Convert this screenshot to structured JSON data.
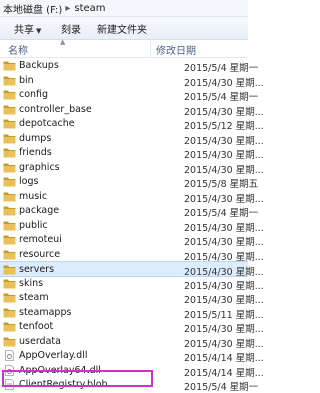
{
  "breadcrumb": {
    "part1": "本地磁盘 (F:)",
    "separator": "▸",
    "part2": "steam"
  },
  "toolbar": {
    "share_label": "共享",
    "burn_label": "刻录",
    "new_folder_label": "新建文件夹"
  },
  "columns": {
    "name": "名称",
    "date": "修改日期"
  },
  "rows": [
    {
      "name": "Backups",
      "date": "2015/5/4 星期一",
      "type": "folder"
    },
    {
      "name": "bin",
      "date": "2015/4/30 星期...",
      "type": "folder"
    },
    {
      "name": "config",
      "date": "2015/5/4 星期一",
      "type": "folder"
    },
    {
      "name": "controller_base",
      "date": "2015/4/30 星期...",
      "type": "folder"
    },
    {
      "name": "depotcache",
      "date": "2015/5/12 星期...",
      "type": "folder"
    },
    {
      "name": "dumps",
      "date": "2015/4/30 星期...",
      "type": "folder"
    },
    {
      "name": "friends",
      "date": "2015/4/30 星期...",
      "type": "folder"
    },
    {
      "name": "graphics",
      "date": "2015/4/30 星期...",
      "type": "folder"
    },
    {
      "name": "logs",
      "date": "2015/5/8 星期五",
      "type": "folder"
    },
    {
      "name": "music",
      "date": "2015/4/30 星期...",
      "type": "folder"
    },
    {
      "name": "package",
      "date": "2015/5/4 星期一",
      "type": "folder"
    },
    {
      "name": "public",
      "date": "2015/4/30 星期...",
      "type": "folder"
    },
    {
      "name": "remoteui",
      "date": "2015/4/30 星期...",
      "type": "folder"
    },
    {
      "name": "resource",
      "date": "2015/4/30 星期...",
      "type": "folder"
    },
    {
      "name": "servers",
      "date": "2015/4/30 星期...",
      "type": "folder"
    },
    {
      "name": "skins",
      "date": "2015/4/30 星期...",
      "type": "folder"
    },
    {
      "name": "steam",
      "date": "2015/4/30 星期...",
      "type": "folder"
    },
    {
      "name": "steamapps",
      "date": "2015/5/11 星期...",
      "type": "folder"
    },
    {
      "name": "tenfoot",
      "date": "2015/4/30 星期...",
      "type": "folder"
    },
    {
      "name": "userdata",
      "date": "2015/4/30 星期...",
      "type": "folder"
    },
    {
      "name": "AppOverlay.dll",
      "date": "2015/4/14 星期...",
      "type": "dll"
    },
    {
      "name": "AppOverlay64.dll",
      "date": "2015/4/14 星期...",
      "type": "dll"
    },
    {
      "name": "ClientRegistry.blob",
      "date": "2015/5/4 星期一",
      "type": "blob"
    }
  ],
  "selected_index": 14,
  "colors": {
    "folder": "#e8c15a",
    "folder_dark": "#c89a2c",
    "highlight": "#cc33cc",
    "selection": "#ddecfc"
  }
}
